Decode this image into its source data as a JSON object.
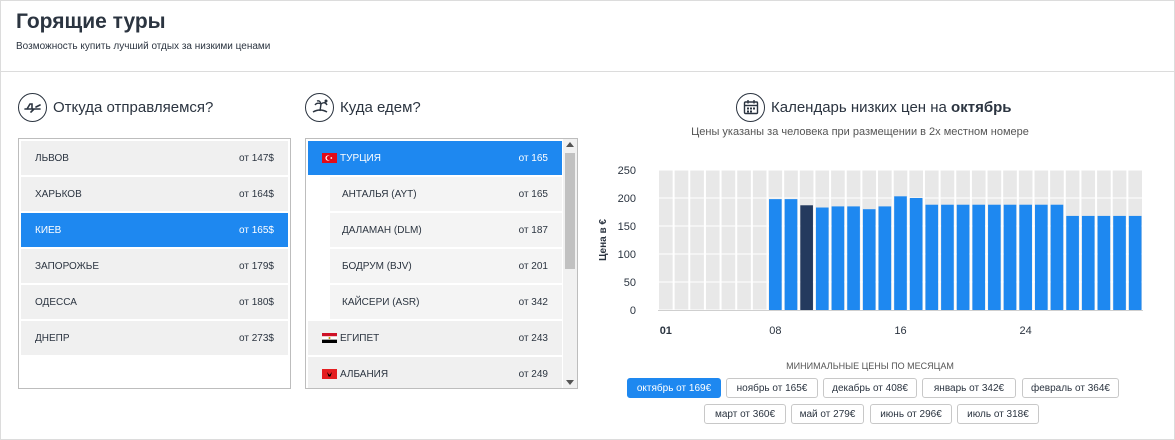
{
  "header": {
    "title": "Горящие туры",
    "subtitle": "Возможность купить лучший отдых за низкими ценами"
  },
  "from": {
    "title": "Откуда отправляемся?",
    "icon": "plane-icon",
    "items": [
      {
        "name": "Львов",
        "price": "от 147$"
      },
      {
        "name": "Харьков",
        "price": "от 164$"
      },
      {
        "name": "Киев",
        "price": "от 165$"
      },
      {
        "name": "Запорожье",
        "price": "от 179$"
      },
      {
        "name": "Одесса",
        "price": "от 180$"
      },
      {
        "name": "Днепр",
        "price": "от 273$"
      }
    ],
    "selected_index": 2
  },
  "to": {
    "title": "Куда едем?",
    "icon": "palm-island-icon",
    "items": [
      {
        "name": "Турция",
        "price": "от 165",
        "type": "country",
        "flag": "turkey-flag-icon"
      },
      {
        "name": "Анталья (AYT)",
        "price": "от 165",
        "type": "city"
      },
      {
        "name": "Даламан (DLM)",
        "price": "от 187",
        "type": "city"
      },
      {
        "name": "Бодрум (BJV)",
        "price": "от 201",
        "type": "city"
      },
      {
        "name": "Кайсери (ASR)",
        "price": "от 342",
        "type": "city"
      },
      {
        "name": "Египет",
        "price": "от 243",
        "type": "country",
        "flag": "egypt-flag-icon"
      },
      {
        "name": "Албания",
        "price": "от 249",
        "type": "country",
        "flag": "albania-flag-icon"
      }
    ],
    "selected_index": 0
  },
  "calendar": {
    "title_prefix": "Календарь низких цен на",
    "title_month": "октябрь",
    "icon": "calendar-icon",
    "subtitle": "Цены указаны за человека при размещении в 2х местном номере",
    "min_prices_label": "Минимальные цены по месяцам",
    "months": [
      {
        "label": "октябрь от 169€",
        "active": true
      },
      {
        "label": "ноябрь от 165€",
        "active": false
      },
      {
        "label": "декабрь от 408€",
        "active": false
      },
      {
        "label": "январь от 342€",
        "active": false
      },
      {
        "label": "февраль от 364€",
        "active": false
      },
      {
        "label": "март от 360€",
        "active": false
      },
      {
        "label": "май от 279€",
        "active": false
      },
      {
        "label": "июнь от 296€",
        "active": false
      },
      {
        "label": "июль от 318€",
        "active": false
      }
    ]
  },
  "colors": {
    "accent": "#1e88f0",
    "bar": "#1e88f0",
    "bar_selected": "#243a5e",
    "text": "#2b3440"
  },
  "chart_data": {
    "type": "bar",
    "ylabel": "Цена в €",
    "xlabel": "",
    "ylim": [
      0,
      250
    ],
    "yticks": [
      0,
      50,
      100,
      150,
      200,
      250
    ],
    "x": [
      1,
      2,
      3,
      4,
      5,
      6,
      7,
      8,
      9,
      10,
      11,
      12,
      13,
      14,
      15,
      16,
      17,
      18,
      19,
      20,
      21,
      22,
      23,
      24,
      25,
      26,
      27,
      28,
      29,
      30,
      31
    ],
    "xtick_labels": [
      {
        "x": 1,
        "label": "01"
      },
      {
        "x": 8,
        "label": "08"
      },
      {
        "x": 16,
        "label": "16"
      },
      {
        "x": 24,
        "label": "24"
      }
    ],
    "values": [
      null,
      null,
      null,
      null,
      null,
      null,
      null,
      198,
      198,
      187,
      183,
      185,
      185,
      180,
      185,
      203,
      200,
      188,
      188,
      188,
      188,
      188,
      188,
      188,
      188,
      188,
      168,
      168,
      168,
      168,
      168
    ],
    "selected_x": 10,
    "grid": true,
    "legend": "none"
  }
}
